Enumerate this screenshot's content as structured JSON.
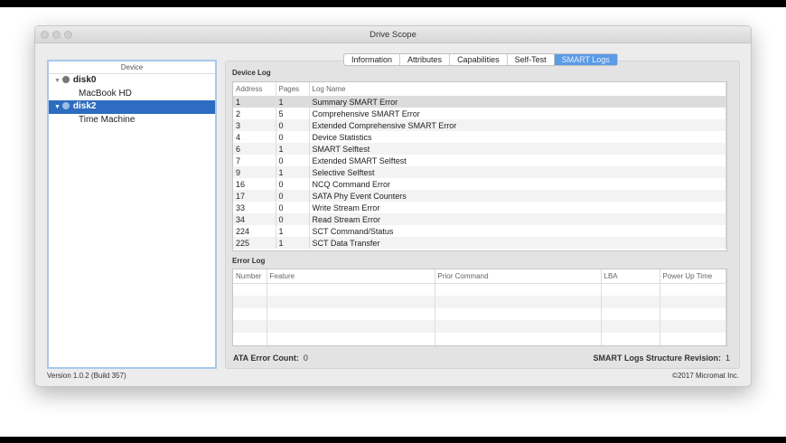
{
  "window": {
    "title": "Drive Scope"
  },
  "sidebar": {
    "header": "Device",
    "items": [
      {
        "label": "disk0",
        "level": 0
      },
      {
        "label": "MacBook HD",
        "level": 1
      },
      {
        "label": "disk2",
        "level": 0,
        "selected": true
      },
      {
        "label": "Time Machine",
        "level": 1
      }
    ]
  },
  "tabs": [
    "Information",
    "Attributes",
    "Capabilities",
    "Self-Test",
    "SMART Logs"
  ],
  "active_tab": "SMART Logs",
  "device_log": {
    "label": "Device Log",
    "columns": [
      "Address",
      "Pages",
      "Log Name"
    ],
    "rows": [
      [
        "1",
        "1",
        "Summary SMART Error"
      ],
      [
        "2",
        "5",
        "Comprehensive SMART Error"
      ],
      [
        "3",
        "0",
        "Extended Comprehensive SMART Error"
      ],
      [
        "4",
        "0",
        "Device Statistics"
      ],
      [
        "6",
        "1",
        "SMART Selftest"
      ],
      [
        "7",
        "0",
        "Extended SMART Selftest"
      ],
      [
        "9",
        "1",
        "Selective Selftest"
      ],
      [
        "16",
        "0",
        "NCQ Command Error"
      ],
      [
        "17",
        "0",
        "SATA Phy Event Counters"
      ],
      [
        "33",
        "0",
        "Write Stream Error"
      ],
      [
        "34",
        "0",
        "Read Stream Error"
      ],
      [
        "224",
        "1",
        "SCT Command/Status"
      ],
      [
        "225",
        "1",
        "SCT Data Transfer"
      ]
    ]
  },
  "error_log": {
    "label": "Error Log",
    "columns": [
      "Number",
      "Feature",
      "Prior Command",
      "LBA",
      "Power Up Time"
    ]
  },
  "ata_error_count": {
    "label": "ATA Error Count:",
    "value": "0"
  },
  "revision": {
    "label": "SMART Logs Structure Revision:",
    "value": "1"
  },
  "footer": {
    "version": "Version 1.0.2 (Build 357)",
    "copyright": "©2017 Micromat Inc."
  }
}
